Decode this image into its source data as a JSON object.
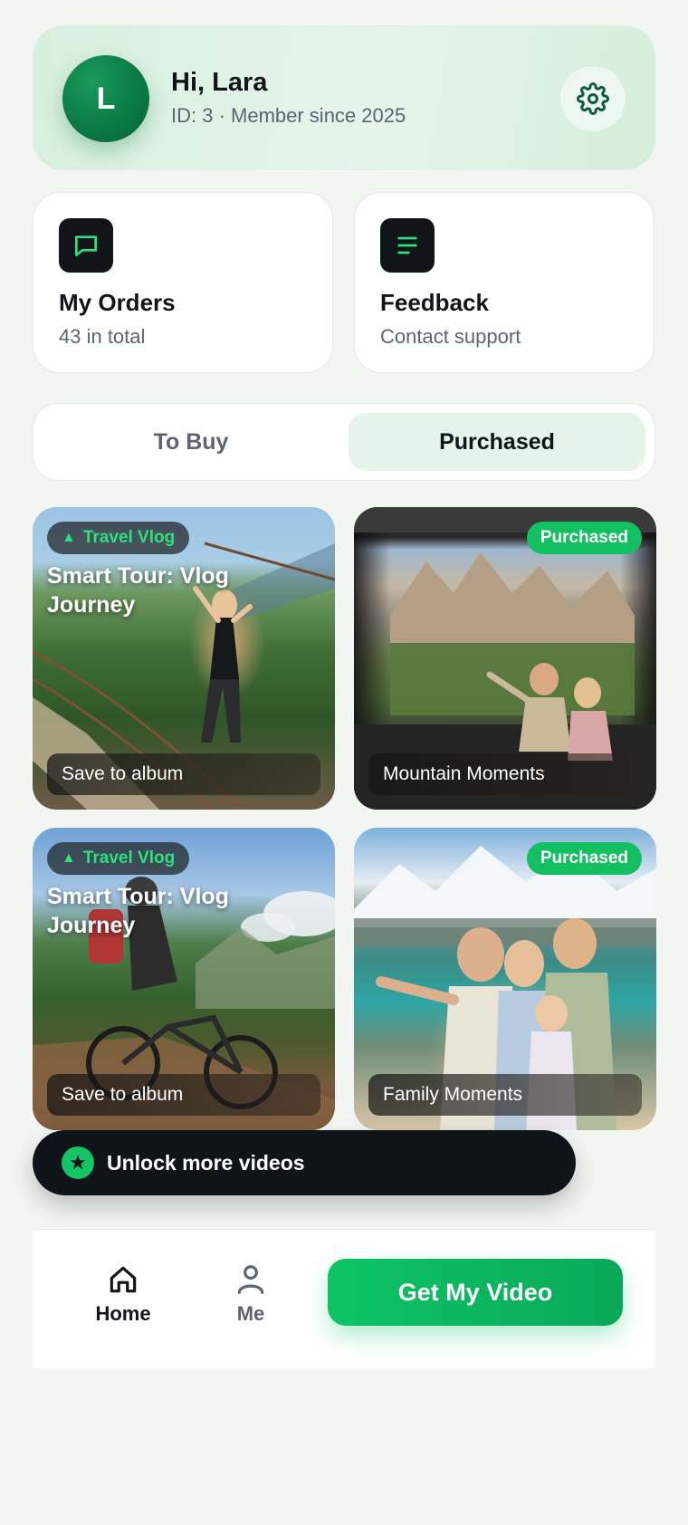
{
  "profile": {
    "avatar_initial": "L",
    "greeting": "Hi, Lara",
    "member_line": "ID: 3 · Member since 2025",
    "settings_icon": "gear-icon"
  },
  "quick_cards": [
    {
      "icon": "chat-icon",
      "title": "My Orders",
      "subtitle": "43 in total"
    },
    {
      "icon": "menu-lines-icon",
      "title": "Feedback",
      "subtitle": "Contact support"
    }
  ],
  "tabs": [
    {
      "label": "To Buy",
      "active": false
    },
    {
      "label": "Purchased",
      "active": true
    }
  ],
  "videos": [
    {
      "tag": "Travel Vlog",
      "tag_type": "vlog",
      "title": "Smart Tour: Vlog Journey",
      "bar": "Save to album"
    },
    {
      "tag": "Purchased",
      "tag_type": "purchased",
      "title": "",
      "bar": "Mountain Moments"
    },
    {
      "tag": "Travel Vlog",
      "tag_type": "vlog",
      "title": "Smart Tour: Vlog Journey",
      "bar": "Save to album"
    },
    {
      "tag": "Purchased",
      "tag_type": "purchased",
      "title": "",
      "bar": "Family Moments"
    }
  ],
  "unlock": {
    "icon": "star-icon",
    "label": "Unlock more videos"
  },
  "nav": {
    "home_label": "Home",
    "me_label": "Me",
    "cta_label": "Get My Video"
  },
  "colors": {
    "accent": "#12c062",
    "dark": "#111418",
    "muted": "#5b6470",
    "header_bg": "#d6f0de"
  }
}
